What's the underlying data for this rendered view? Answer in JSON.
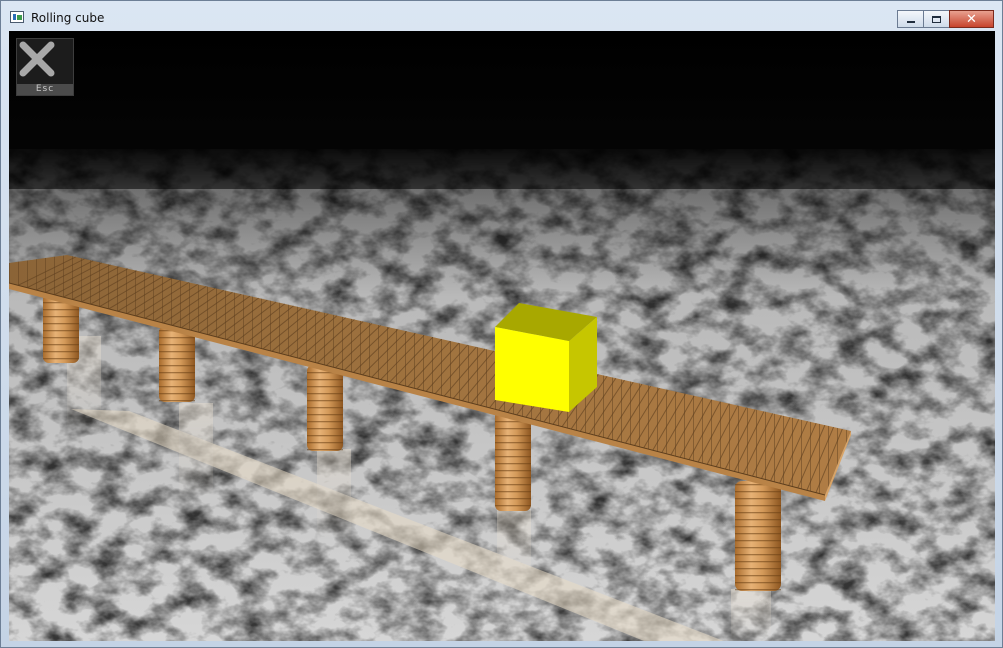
{
  "window": {
    "title": "Rolling cube"
  },
  "titlebar_buttons": {
    "minimize": "minimize",
    "maximize": "maximize",
    "close": "close"
  },
  "hud": {
    "esc_label": "Esc"
  },
  "scene": {
    "floor": "marble",
    "bridge": "wooden-plank-bridge",
    "pillar_count": 5,
    "cube_color": "#ffff00",
    "cube_shade_top": "#a8a800",
    "cube_shade_side": "#c6c600",
    "wood_color": "#b07a3c",
    "sky_color": "#000000"
  }
}
